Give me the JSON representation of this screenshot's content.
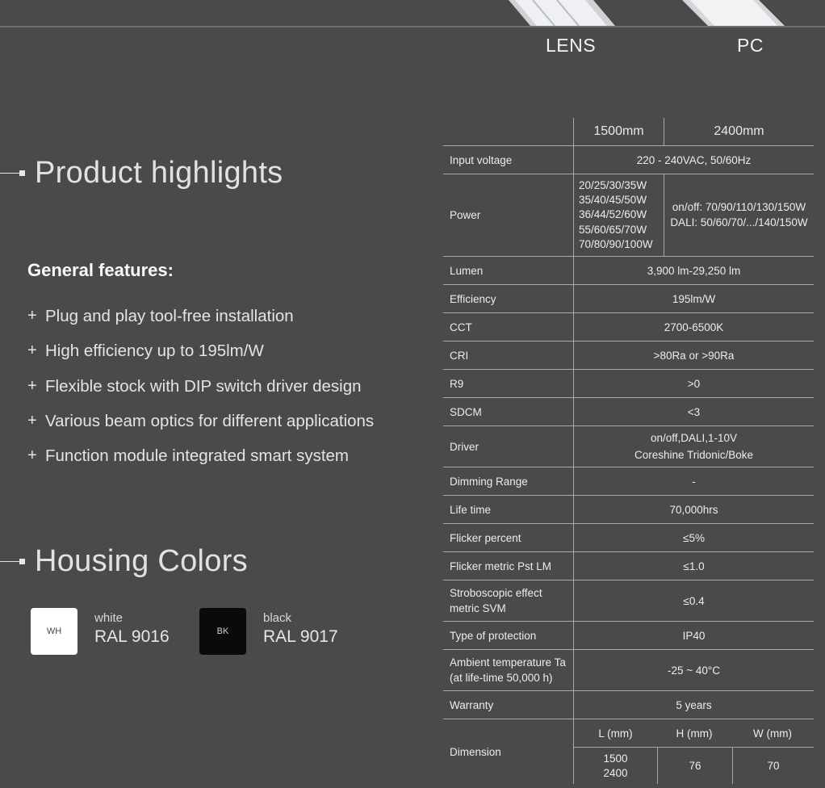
{
  "product_types": {
    "lens": "LENS",
    "pc": "PC"
  },
  "highlights": {
    "title": "Product highlights",
    "general_title": "General features:",
    "bullet": "+",
    "features": [
      "Plug and play tool-free installation",
      "High efficiency up to 195lm/W",
      "Flexible stock with DIP switch driver design",
      "Various beam optics for different applications",
      "Function module integrated smart system"
    ]
  },
  "housing": {
    "title": "Housing Colors",
    "colors": [
      {
        "code": "WH",
        "name": "white",
        "ral": "RAL 9016",
        "swatch": "#ffffff",
        "code_color": "#444444"
      },
      {
        "code": "BK",
        "name": "black",
        "ral": "RAL 9017",
        "swatch": "#0a0a0a",
        "code_color": "#cfcfcf"
      }
    ]
  },
  "spec": {
    "columns": [
      "1500mm",
      "2400mm"
    ],
    "rows": {
      "input_voltage": {
        "label": "Input voltage",
        "value": "220 - 240VAC, 50/60Hz"
      },
      "power": {
        "label": "Power",
        "v1500": [
          "20/25/30/35W",
          "35/40/45/50W",
          "36/44/52/60W",
          "55/60/65/70W",
          "70/80/90/100W"
        ],
        "v2400": [
          "on/off: 70/90/110/130/150W",
          "DALI: 50/60/70/.../140/150W"
        ]
      },
      "lumen": {
        "label": "Lumen",
        "value": "3,900 lm-29,250 lm"
      },
      "efficiency": {
        "label": "Efficiency",
        "value": "195lm/W"
      },
      "cct": {
        "label": "CCT",
        "value": "2700-6500K"
      },
      "cri": {
        "label": "CRI",
        "value": ">80Ra or >90Ra"
      },
      "r9": {
        "label": "R9",
        "value": ">0"
      },
      "sdcm": {
        "label": "SDCM",
        "value": "<3"
      },
      "driver": {
        "label": "Driver",
        "value_line1": "on/off,DALI,1-10V",
        "value_line2": "Coreshine Tridonic/Boke"
      },
      "dimming": {
        "label": "Dimming Range",
        "value": "-"
      },
      "life": {
        "label": "Life time",
        "value": "70,000hrs"
      },
      "flicker_percent": {
        "label": "Flicker percent",
        "value": "≤5%"
      },
      "flicker_pst": {
        "label": "Flicker metric Pst LM",
        "value": "≤1.0"
      },
      "stroboscopic": {
        "label_line1": "Stroboscopic effect",
        "label_line2": "metric SVM",
        "value": "≤0.4"
      },
      "protection": {
        "label": "Type of protection",
        "value": "IP40"
      },
      "ambient": {
        "label_line1": "Ambient temperature Ta",
        "label_line2": "(at life-time 50,000 h)",
        "value": "-25 ~ 40°C"
      },
      "warranty": {
        "label": "Warranty",
        "value": "5 years"
      },
      "dimension": {
        "label": "Dimension",
        "headers": [
          "L (mm)",
          "H (mm)",
          "W (mm)"
        ],
        "l_values": [
          "1500",
          "2400"
        ],
        "h": "76",
        "w": "70"
      }
    }
  }
}
